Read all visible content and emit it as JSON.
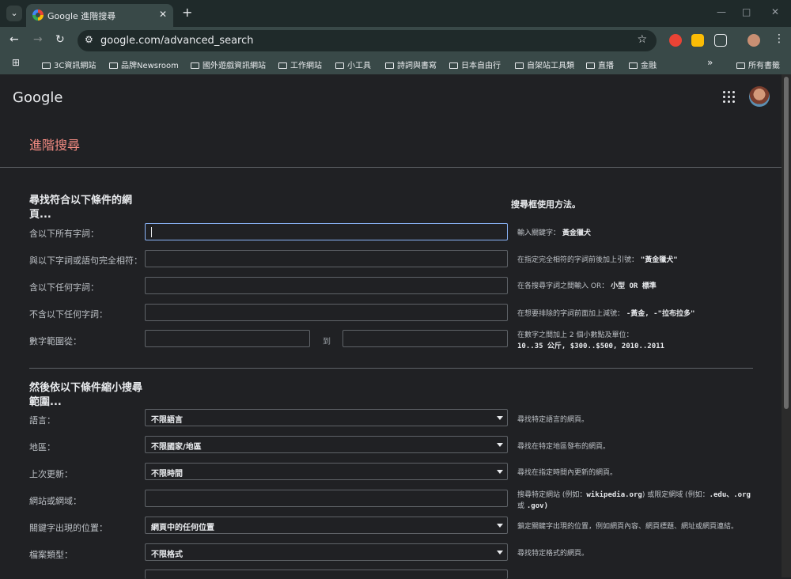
{
  "browser": {
    "tab_title": "Google 進階搜尋",
    "url": "google.com/advanced_search",
    "bookmarks": [
      "3C資訊網站",
      "品牌Newsroom",
      "國外遊戲資訊網站",
      "工作網站",
      "小工具",
      "詩詞與書寫",
      "日本自由行",
      "自架站工具類",
      "直播",
      "金融"
    ],
    "all_bookmarks": "所有書籤",
    "overflow": "»"
  },
  "header": {
    "logo": "Google",
    "page_title": "進階搜尋"
  },
  "sections": {
    "find_pages": {
      "title": "尋找符合以下條件的網頁...",
      "help_title": "搜尋框使用方法。"
    },
    "narrow": {
      "title": "然後依以下條件縮小搜尋範圍..."
    }
  },
  "fields": [
    {
      "label": "含以下所有字詞：",
      "help": "輸入關鍵字：",
      "example": "黃金獵犬"
    },
    {
      "label": "與以下字詞或語句完全相符：",
      "help": "在指定完全相符的字詞前後加上引號：",
      "example": "\"黃金獵犬\""
    },
    {
      "label": "含以下任何字詞：",
      "help": "在各搜尋字詞之間輸入 OR：",
      "example": "小型 OR 標準"
    },
    {
      "label": "不含以下任何字詞：",
      "help": "在想要排除的字詞前面加上減號：",
      "example": "-黃金, -\"拉布拉多\""
    },
    {
      "label": "數字範圍從：",
      "to": "到",
      "help": "在數字之間加上 2 個小數點及單位：",
      "example": "10..35 公斤, $300..$500, 2010..2011"
    }
  ],
  "filters": [
    {
      "label": "語言：",
      "value": "不限語言",
      "help": "尋找特定語言的網頁。"
    },
    {
      "label": "地區：",
      "value": "不限國家/地區",
      "help": "尋找在特定地區發布的網頁。"
    },
    {
      "label": "上次更新：",
      "value": "不限時間",
      "help": "尋找在指定時間內更新的網頁。"
    },
    {
      "label": "網站或網域：",
      "value": "",
      "help": "搜尋特定網站 (例如：",
      "help_example": "wikipedia.org",
      "help_mid": ") 或限定網域 (例如：",
      "help_ex2": ".edu、.org",
      "help_end": "或",
      "help_ex3": ".gov)"
    },
    {
      "label": "關鍵字出現的位置：",
      "value": "網頁中的任何位置",
      "help": "鎖定關鍵字出現的位置，例如網頁內容、網頁標題、網址或網頁連結。"
    },
    {
      "label": "檔案類型：",
      "value": "不限格式",
      "help": "尋找特定格式的網頁。"
    }
  ]
}
